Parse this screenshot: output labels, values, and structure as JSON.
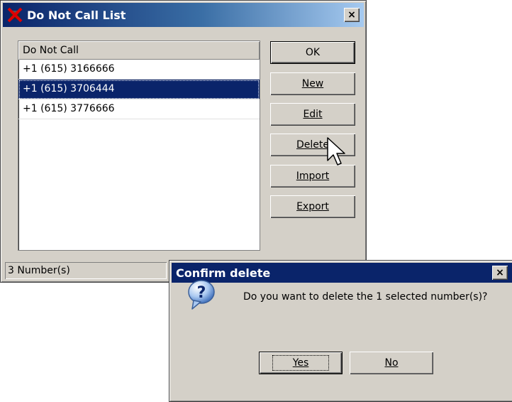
{
  "main_dialog": {
    "title": "Do Not Call List",
    "close_glyph": "×",
    "list": {
      "header": "Do Not Call",
      "items": [
        "+1 (615) 3166666",
        "+1 (615) 3706444",
        "+1 (615) 3776666"
      ],
      "selected_index": 1
    },
    "buttons": {
      "ok": "OK",
      "new": "New",
      "edit": "Edit",
      "delete": "Delete",
      "import": "Import",
      "export": "Export"
    },
    "status": "3 Number(s)"
  },
  "confirm_dialog": {
    "title": "Confirm delete",
    "close_glyph": "×",
    "icon": "question-icon",
    "message": "Do you want to delete the 1 selected number(s)?",
    "buttons": {
      "yes": "Yes",
      "no": "No"
    }
  },
  "colors": {
    "selection": "#0a246a",
    "face": "#d4d0c8",
    "title_dark": "#0a246a"
  },
  "cursor": "arrow-cursor-icon"
}
